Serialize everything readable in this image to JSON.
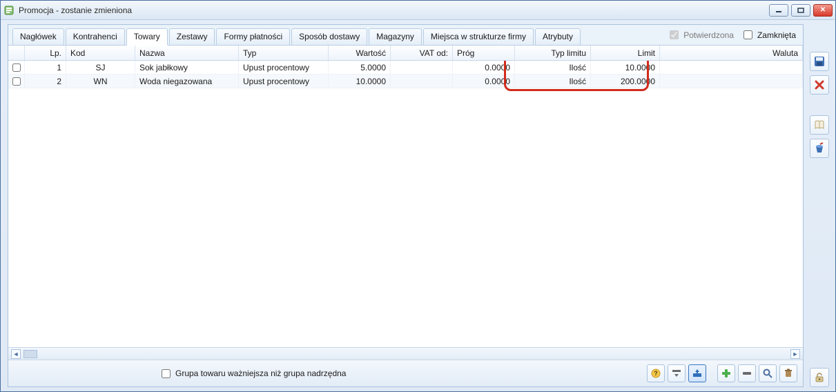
{
  "window": {
    "title": "Promocja - zostanie zmieniona"
  },
  "tabs": [
    {
      "id": "naglowek",
      "label": "Nagłówek"
    },
    {
      "id": "kontrahenci",
      "label": "Kontrahenci"
    },
    {
      "id": "towary",
      "label": "Towary",
      "active": true
    },
    {
      "id": "zestawy",
      "label": "Zestawy"
    },
    {
      "id": "formy",
      "label": "Formy płatności"
    },
    {
      "id": "dostawa",
      "label": "Sposób dostawy"
    },
    {
      "id": "magazyny",
      "label": "Magazyny"
    },
    {
      "id": "miejsca",
      "label": "Miejsca w strukturze firmy"
    },
    {
      "id": "atrybuty",
      "label": "Atrybuty"
    }
  ],
  "status": {
    "confirmed_label": "Potwierdzona",
    "confirmed_checked": true,
    "closed_label": "Zamknięta",
    "closed_checked": false
  },
  "grid": {
    "headers": {
      "lp": "Lp.",
      "kod": "Kod",
      "nazwa": "Nazwa",
      "typ": "Typ",
      "wartosc": "Wartość",
      "vatod": "VAT od:",
      "prog": "Próg",
      "typ_limitu": "Typ limitu",
      "limit": "Limit",
      "waluta": "Waluta"
    },
    "rows": [
      {
        "lp": "1",
        "kod": "SJ",
        "nazwa": "Sok jabłkowy",
        "typ": "Upust procentowy",
        "wartosc": "5.0000",
        "vatod": "",
        "prog": "0.0000",
        "typ_limitu": "Ilość",
        "limit": "10.0000",
        "waluta": ""
      },
      {
        "lp": "2",
        "kod": "WN",
        "nazwa": "Woda niegazowana",
        "typ": "Upust procentowy",
        "wartosc": "10.0000",
        "vatod": "",
        "prog": "0.0000",
        "typ_limitu": "Ilość",
        "limit": "200.0000",
        "waluta": ""
      }
    ]
  },
  "footer": {
    "checkbox_label": "Grupa towaru ważniejsza niż grupa nadrzędna",
    "checkbox_checked": false
  },
  "icons": {
    "save": "save-icon",
    "delete": "delete-icon",
    "book": "book-icon",
    "bucket": "bucket-icon",
    "lock": "lock-open-icon",
    "help": "help-icon",
    "options": "options-icon",
    "export": "export-icon",
    "add": "add-icon",
    "remove": "remove-icon",
    "search": "search-icon",
    "trash": "trash-icon"
  }
}
